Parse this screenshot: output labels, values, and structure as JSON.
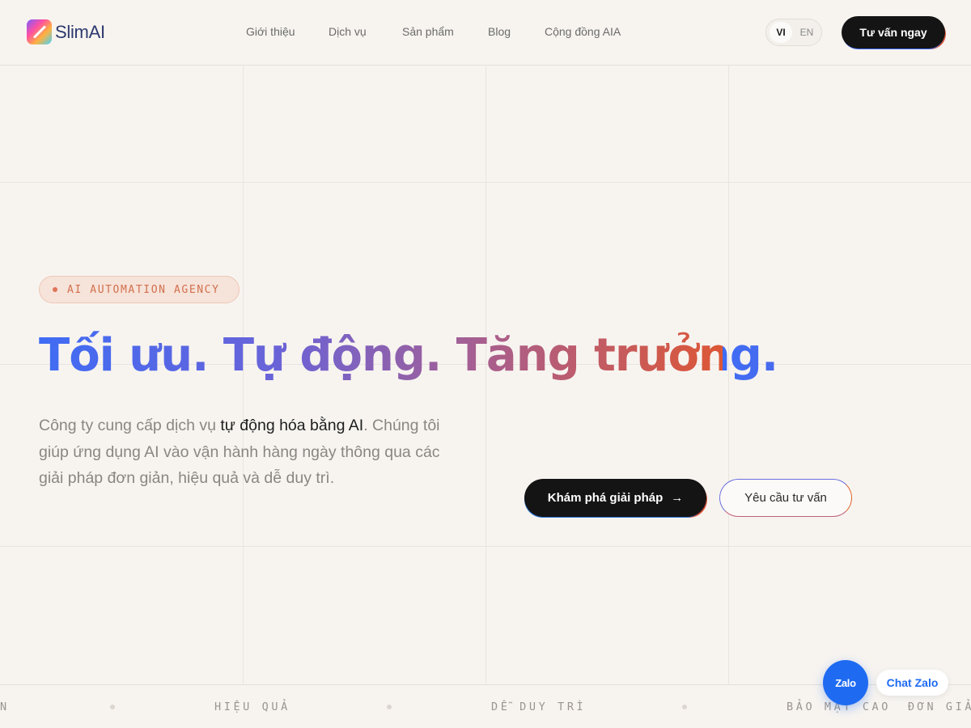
{
  "brand": {
    "name": "SlimAI"
  },
  "nav": {
    "items": [
      {
        "label": "Giới thiệu"
      },
      {
        "label": "Dịch vụ"
      },
      {
        "label": "Sản phẩm"
      },
      {
        "label": "Blog"
      },
      {
        "label": "Cộng đồng AIA"
      }
    ]
  },
  "lang": {
    "vi": "VI",
    "en": "EN",
    "active": "VI"
  },
  "header_cta": {
    "label": "Tư vấn ngay"
  },
  "hero": {
    "badge": "AI AUTOMATION AGENCY",
    "headline": "Tối ưu. Tự động. Tăng trưởng.",
    "desc_part1": "Công ty cung cấp dịch vụ ",
    "desc_highlight": "tự động hóa bằng AI",
    "desc_part2": ". Chúng tôi giúp ứng dụng AI vào vận hành hàng ngày thông qua các giải pháp đơn giản, hiệu quả và dễ duy trì.",
    "primary_cta": "Khám phá giải pháp",
    "primary_cta_arrow": "→",
    "secondary_cta": "Yêu cầu tư vấn"
  },
  "marquee": {
    "items": [
      "N",
      "HIỆU QUẢ",
      "DỄ DUY TRÌ",
      "BẢO MẬT CAO",
      "ĐƠN GIẢ"
    ]
  },
  "zalo": {
    "icon_label": "Zalo",
    "chat_label": "Chat Zalo",
    "color": "#1e6bf2"
  },
  "colors": {
    "background": "#f7f4f0",
    "gradient_start": "#3f6cf4",
    "gradient_end": "#dd5736",
    "badge_text": "#d2704f"
  }
}
